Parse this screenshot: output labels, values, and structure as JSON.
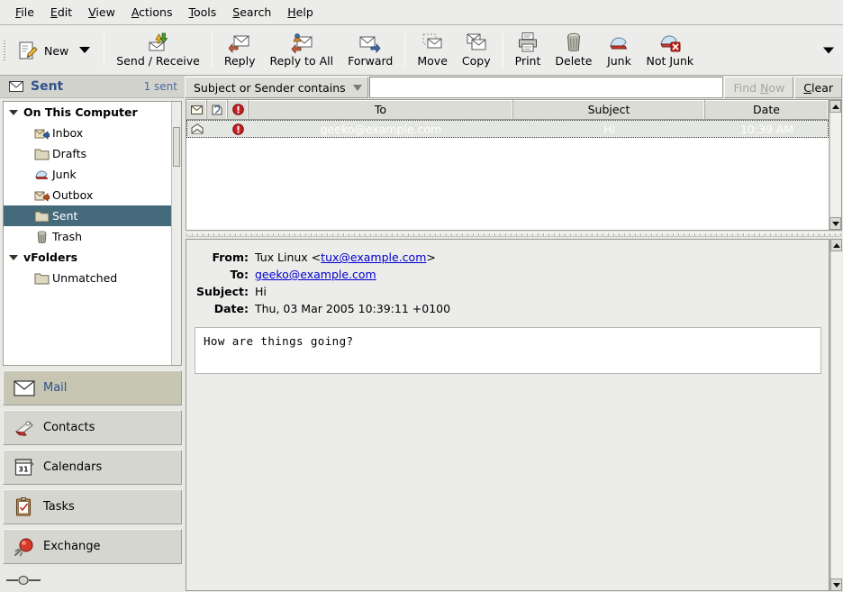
{
  "window": {
    "title": "Evolution - Sent"
  },
  "menubar": {
    "items": [
      {
        "label": "File",
        "accel": "F"
      },
      {
        "label": "Edit",
        "accel": "E"
      },
      {
        "label": "View",
        "accel": "V"
      },
      {
        "label": "Actions",
        "accel": "A"
      },
      {
        "label": "Tools",
        "accel": "T"
      },
      {
        "label": "Search",
        "accel": "S"
      },
      {
        "label": "Help",
        "accel": "H"
      }
    ]
  },
  "toolbar": {
    "new_label": "New",
    "new_icon": "compose-new-icon",
    "buttons": [
      {
        "label": "Send / Receive",
        "icon": "send-receive-icon"
      },
      {
        "label": "Reply",
        "icon": "reply-icon"
      },
      {
        "label": "Reply to All",
        "icon": "reply-all-icon"
      },
      {
        "label": "Forward",
        "icon": "forward-icon"
      },
      {
        "label": "Move",
        "icon": "move-icon"
      },
      {
        "label": "Copy",
        "icon": "copy-icon"
      },
      {
        "label": "Print",
        "icon": "print-icon"
      },
      {
        "label": "Delete",
        "icon": "delete-trash-icon"
      },
      {
        "label": "Junk",
        "icon": "junk-icon"
      },
      {
        "label": "Not Junk",
        "icon": "not-junk-icon"
      }
    ],
    "overflow_icon": "toolbar-overflow-arrow-icon"
  },
  "sidebar": {
    "banner": {
      "icon": "envelope-icon",
      "title": "Sent",
      "count": "1 sent"
    },
    "tree": [
      {
        "label": "On This Computer",
        "type": "root",
        "icon": "disclosure-triangle-icon",
        "selected": false
      },
      {
        "label": "Inbox",
        "type": "folder",
        "icon": "inbox-icon",
        "selected": false
      },
      {
        "label": "Drafts",
        "type": "folder",
        "icon": "folder-icon",
        "selected": false
      },
      {
        "label": "Junk",
        "type": "folder",
        "icon": "junk-icon",
        "selected": false
      },
      {
        "label": "Outbox",
        "type": "folder",
        "icon": "outbox-icon",
        "selected": false
      },
      {
        "label": "Sent",
        "type": "folder",
        "icon": "folder-icon",
        "selected": true
      },
      {
        "label": "Trash",
        "type": "folder",
        "icon": "trash-icon",
        "selected": false
      },
      {
        "label": "vFolders",
        "type": "root",
        "icon": "disclosure-triangle-icon",
        "selected": false
      },
      {
        "label": "Unmatched",
        "type": "folder",
        "icon": "folder-icon",
        "selected": false
      }
    ],
    "shortcuts": [
      {
        "label": "Mail",
        "icon": "mail-icon",
        "active": true
      },
      {
        "label": "Contacts",
        "icon": "contacts-icon",
        "active": false
      },
      {
        "label": "Calendars",
        "icon": "calendar-icon",
        "active": false
      },
      {
        "label": "Tasks",
        "icon": "tasks-icon",
        "active": false
      },
      {
        "label": "Exchange",
        "icon": "exchange-icon",
        "active": false
      }
    ]
  },
  "search": {
    "scope_label": "Subject or Sender contains",
    "scope_icon": "dropdown-triangle-icon",
    "value": "",
    "placeholder": "",
    "find_now_label": "Find Now",
    "find_now_accel": "N",
    "find_now_disabled": true,
    "clear_label": "Clear",
    "clear_accel": "C"
  },
  "message_list": {
    "columns": [
      {
        "label": "",
        "icon": "read-status-envelope-icon",
        "kind": "icon"
      },
      {
        "label": "",
        "icon": "attachment-flag-icon",
        "kind": "icon"
      },
      {
        "label": "",
        "icon": "priority-important-icon",
        "kind": "icon"
      },
      {
        "label": "To",
        "kind": "text"
      },
      {
        "label": "Subject",
        "kind": "text"
      },
      {
        "label": "Date",
        "kind": "text"
      }
    ],
    "rows": [
      {
        "read_icon": "opened-envelope-icon",
        "attach_icon": "",
        "priority_icon": "priority-important-icon",
        "to": "geeko@example.com",
        "subject": "Hi",
        "date": "10:39 AM",
        "selected": true
      }
    ]
  },
  "preview": {
    "headers": [
      {
        "label": "From:",
        "value": "Tux Linux <tux@example.com>",
        "link": "tux@example.com"
      },
      {
        "label": "To:",
        "value": "geeko@example.com",
        "link": "geeko@example.com"
      },
      {
        "label": "Subject:",
        "value": "Hi",
        "link": ""
      },
      {
        "label": "Date:",
        "value": "Thu, 03 Mar 2005 10:39:11 +0100",
        "link": ""
      }
    ],
    "body": "How are things going?"
  },
  "statusbar": {
    "resizer_icon": "pane-resize-grip-icon"
  },
  "colors": {
    "chrome": "#ececeb",
    "selection": "#456a7c",
    "accent_blue": "#30518c",
    "link": "#0000cf",
    "active_shortcut": "#c6c6b2",
    "priority_red": "#cc2020"
  }
}
